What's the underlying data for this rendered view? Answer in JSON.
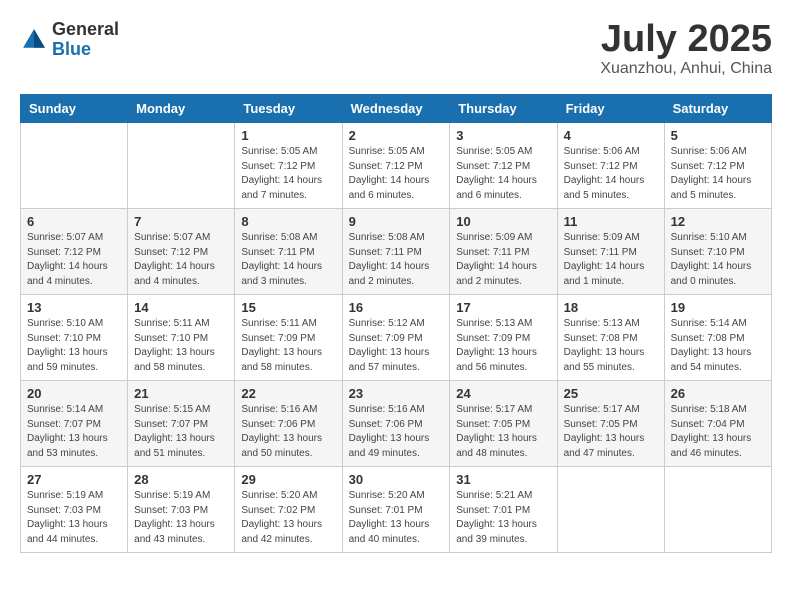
{
  "header": {
    "logo_general": "General",
    "logo_blue": "Blue",
    "month_title": "July 2025",
    "location": "Xuanzhou, Anhui, China"
  },
  "weekdays": [
    "Sunday",
    "Monday",
    "Tuesday",
    "Wednesday",
    "Thursday",
    "Friday",
    "Saturday"
  ],
  "weeks": [
    [
      {
        "day": "",
        "info": ""
      },
      {
        "day": "",
        "info": ""
      },
      {
        "day": "1",
        "info": "Sunrise: 5:05 AM\nSunset: 7:12 PM\nDaylight: 14 hours and 7 minutes."
      },
      {
        "day": "2",
        "info": "Sunrise: 5:05 AM\nSunset: 7:12 PM\nDaylight: 14 hours and 6 minutes."
      },
      {
        "day": "3",
        "info": "Sunrise: 5:05 AM\nSunset: 7:12 PM\nDaylight: 14 hours and 6 minutes."
      },
      {
        "day": "4",
        "info": "Sunrise: 5:06 AM\nSunset: 7:12 PM\nDaylight: 14 hours and 5 minutes."
      },
      {
        "day": "5",
        "info": "Sunrise: 5:06 AM\nSunset: 7:12 PM\nDaylight: 14 hours and 5 minutes."
      }
    ],
    [
      {
        "day": "6",
        "info": "Sunrise: 5:07 AM\nSunset: 7:12 PM\nDaylight: 14 hours and 4 minutes."
      },
      {
        "day": "7",
        "info": "Sunrise: 5:07 AM\nSunset: 7:12 PM\nDaylight: 14 hours and 4 minutes."
      },
      {
        "day": "8",
        "info": "Sunrise: 5:08 AM\nSunset: 7:11 PM\nDaylight: 14 hours and 3 minutes."
      },
      {
        "day": "9",
        "info": "Sunrise: 5:08 AM\nSunset: 7:11 PM\nDaylight: 14 hours and 2 minutes."
      },
      {
        "day": "10",
        "info": "Sunrise: 5:09 AM\nSunset: 7:11 PM\nDaylight: 14 hours and 2 minutes."
      },
      {
        "day": "11",
        "info": "Sunrise: 5:09 AM\nSunset: 7:11 PM\nDaylight: 14 hours and 1 minute."
      },
      {
        "day": "12",
        "info": "Sunrise: 5:10 AM\nSunset: 7:10 PM\nDaylight: 14 hours and 0 minutes."
      }
    ],
    [
      {
        "day": "13",
        "info": "Sunrise: 5:10 AM\nSunset: 7:10 PM\nDaylight: 13 hours and 59 minutes."
      },
      {
        "day": "14",
        "info": "Sunrise: 5:11 AM\nSunset: 7:10 PM\nDaylight: 13 hours and 58 minutes."
      },
      {
        "day": "15",
        "info": "Sunrise: 5:11 AM\nSunset: 7:09 PM\nDaylight: 13 hours and 58 minutes."
      },
      {
        "day": "16",
        "info": "Sunrise: 5:12 AM\nSunset: 7:09 PM\nDaylight: 13 hours and 57 minutes."
      },
      {
        "day": "17",
        "info": "Sunrise: 5:13 AM\nSunset: 7:09 PM\nDaylight: 13 hours and 56 minutes."
      },
      {
        "day": "18",
        "info": "Sunrise: 5:13 AM\nSunset: 7:08 PM\nDaylight: 13 hours and 55 minutes."
      },
      {
        "day": "19",
        "info": "Sunrise: 5:14 AM\nSunset: 7:08 PM\nDaylight: 13 hours and 54 minutes."
      }
    ],
    [
      {
        "day": "20",
        "info": "Sunrise: 5:14 AM\nSunset: 7:07 PM\nDaylight: 13 hours and 53 minutes."
      },
      {
        "day": "21",
        "info": "Sunrise: 5:15 AM\nSunset: 7:07 PM\nDaylight: 13 hours and 51 minutes."
      },
      {
        "day": "22",
        "info": "Sunrise: 5:16 AM\nSunset: 7:06 PM\nDaylight: 13 hours and 50 minutes."
      },
      {
        "day": "23",
        "info": "Sunrise: 5:16 AM\nSunset: 7:06 PM\nDaylight: 13 hours and 49 minutes."
      },
      {
        "day": "24",
        "info": "Sunrise: 5:17 AM\nSunset: 7:05 PM\nDaylight: 13 hours and 48 minutes."
      },
      {
        "day": "25",
        "info": "Sunrise: 5:17 AM\nSunset: 7:05 PM\nDaylight: 13 hours and 47 minutes."
      },
      {
        "day": "26",
        "info": "Sunrise: 5:18 AM\nSunset: 7:04 PM\nDaylight: 13 hours and 46 minutes."
      }
    ],
    [
      {
        "day": "27",
        "info": "Sunrise: 5:19 AM\nSunset: 7:03 PM\nDaylight: 13 hours and 44 minutes."
      },
      {
        "day": "28",
        "info": "Sunrise: 5:19 AM\nSunset: 7:03 PM\nDaylight: 13 hours and 43 minutes."
      },
      {
        "day": "29",
        "info": "Sunrise: 5:20 AM\nSunset: 7:02 PM\nDaylight: 13 hours and 42 minutes."
      },
      {
        "day": "30",
        "info": "Sunrise: 5:20 AM\nSunset: 7:01 PM\nDaylight: 13 hours and 40 minutes."
      },
      {
        "day": "31",
        "info": "Sunrise: 5:21 AM\nSunset: 7:01 PM\nDaylight: 13 hours and 39 minutes."
      },
      {
        "day": "",
        "info": ""
      },
      {
        "day": "",
        "info": ""
      }
    ]
  ]
}
